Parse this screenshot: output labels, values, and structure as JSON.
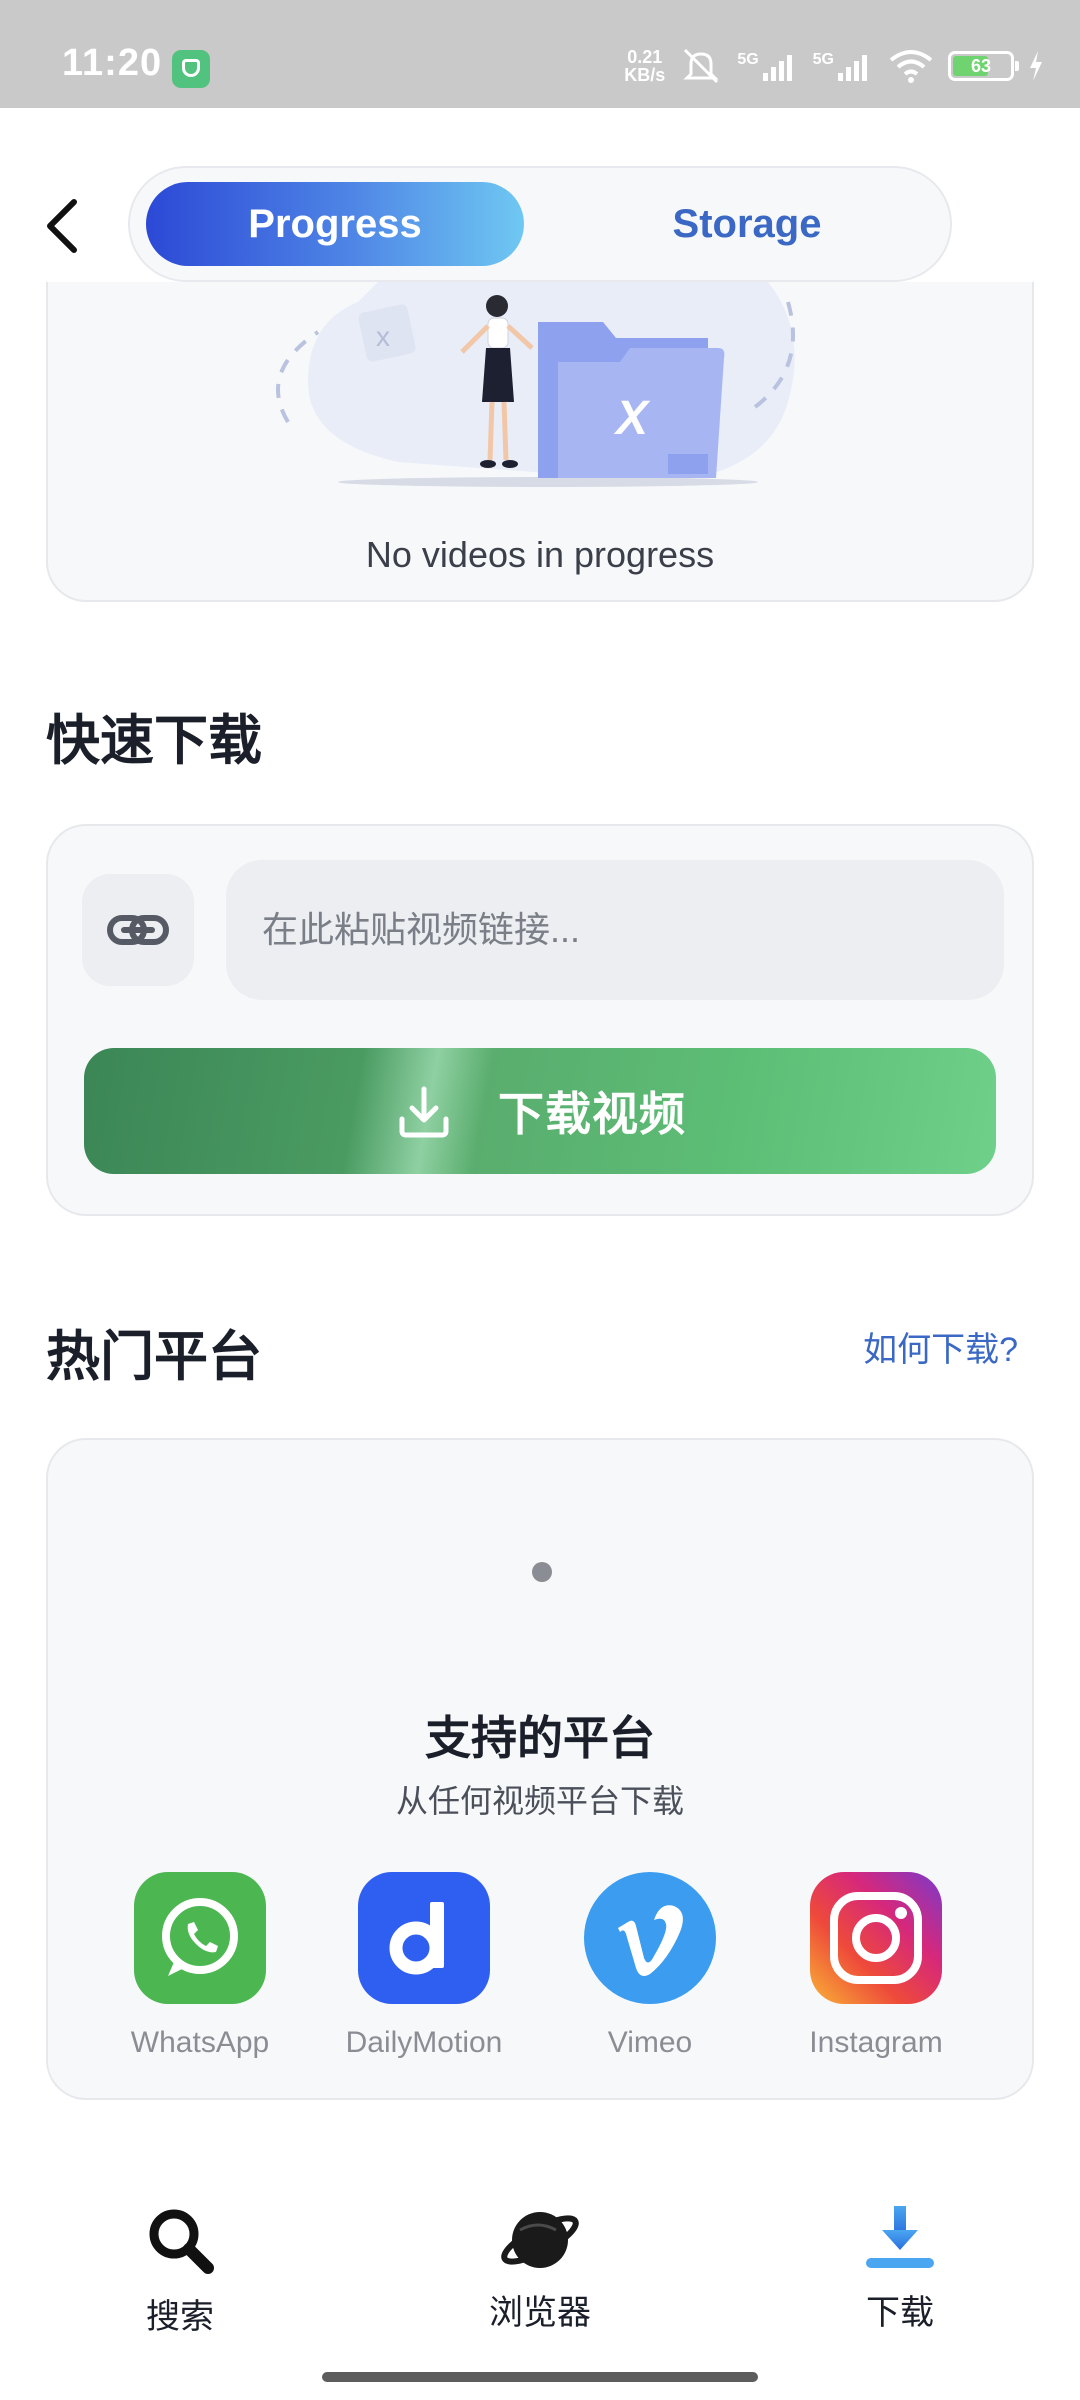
{
  "status_bar": {
    "time": "11:20",
    "net_speed_value": "0.21",
    "net_speed_unit": "KB/s",
    "signal_1": "5G",
    "signal_2": "5G",
    "battery": "63",
    "battery_level": 0.63
  },
  "header": {
    "tabs": [
      {
        "label": "Progress",
        "active": true
      },
      {
        "label": "Storage",
        "active": false
      }
    ]
  },
  "progress_card": {
    "empty_text": "No videos in progress"
  },
  "quick_download": {
    "title": "快速下载",
    "input_placeholder": "在此粘贴视频链接...",
    "input_value": "",
    "button_label": "下载视频"
  },
  "platforms": {
    "title": "热门平台",
    "help_link": "如何下载?",
    "card_title": "支持的平台",
    "card_subtitle": "从任何视频平台下载",
    "items": [
      {
        "name": "WhatsApp",
        "icon": "whatsapp-icon",
        "color": "#4cb650"
      },
      {
        "name": "DailyMotion",
        "icon": "dailymotion-icon",
        "color": "#2f5ff0"
      },
      {
        "name": "Vimeo",
        "icon": "vimeo-icon",
        "color": "#3b9cf0"
      },
      {
        "name": "Instagram",
        "icon": "instagram-icon",
        "color": "#d6287b"
      }
    ]
  },
  "bottom_nav": {
    "items": [
      {
        "label": "搜索",
        "icon": "search-icon"
      },
      {
        "label": "浏览器",
        "icon": "planet-icon"
      },
      {
        "label": "下载",
        "icon": "download-icon",
        "active": true
      }
    ]
  },
  "colors": {
    "accent_blue": "#3a68c4",
    "download_green": "#4fae6a"
  }
}
